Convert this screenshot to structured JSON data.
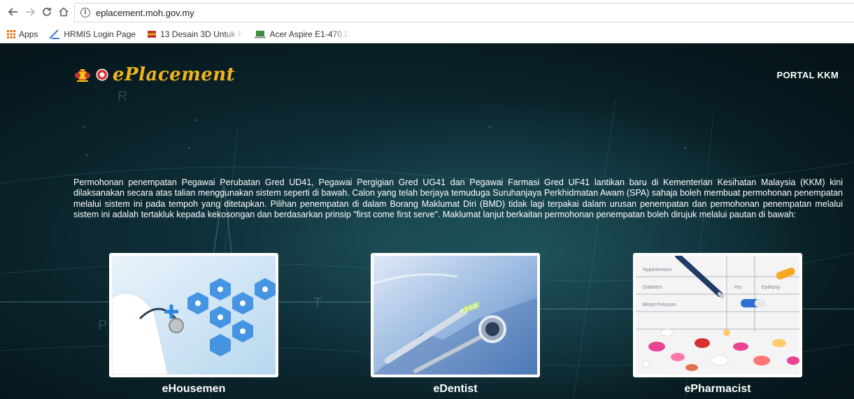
{
  "browser": {
    "url": "eplacement.moh.gov.my",
    "bookmarks": [
      {
        "label": "Apps",
        "icon": "apps-grid-icon"
      },
      {
        "label": "HRMIS Login Page",
        "icon": "hrmis-icon"
      },
      {
        "label": "13 Desain 3D Untuk R",
        "icon": "book-icon"
      },
      {
        "label": "Acer Aspire E1-470 D",
        "icon": "laptop-icon"
      }
    ]
  },
  "header": {
    "logo_text": "ePlacement",
    "portal_link": "PORTAL KKM"
  },
  "intro_text": "Permohonan penempatan Pegawai Perubatan Gred UD41, Pegawai Pergigian Gred UG41 dan Pegawai Farmasi Gred UF41 lantikan baru di Kementerian Kesihatan Malaysia (KKM) kini dilaksanakan secara atas talian menggunakan sistem seperti di bawah. Calon yang telah berjaya temuduga Suruhanjaya Perkhidmatan Awam (SPA) sahaja boleh membuat permohonan penempatan melalui sistem ini pada tempoh yang ditetapkan. Pilihan penempatan di dalam Borang Maklumat Diri (BMD) tidak lagi terpakai dalam urusan penempatan dan permohonan penempatan melalui sistem ini adalah tertakluk kepada kekosongan dan berdasarkan prinsip \"first come first serve\". Maklumat lanjut berkaitan permohonan penempatan boleh dirujuk melalui pautan di bawah:",
  "cards": [
    {
      "title": "eHousemen"
    },
    {
      "title": "eDentist"
    },
    {
      "title": "ePharmacist"
    }
  ],
  "colors": {
    "logo": "#f0b21e",
    "background": "#0d2a33"
  }
}
